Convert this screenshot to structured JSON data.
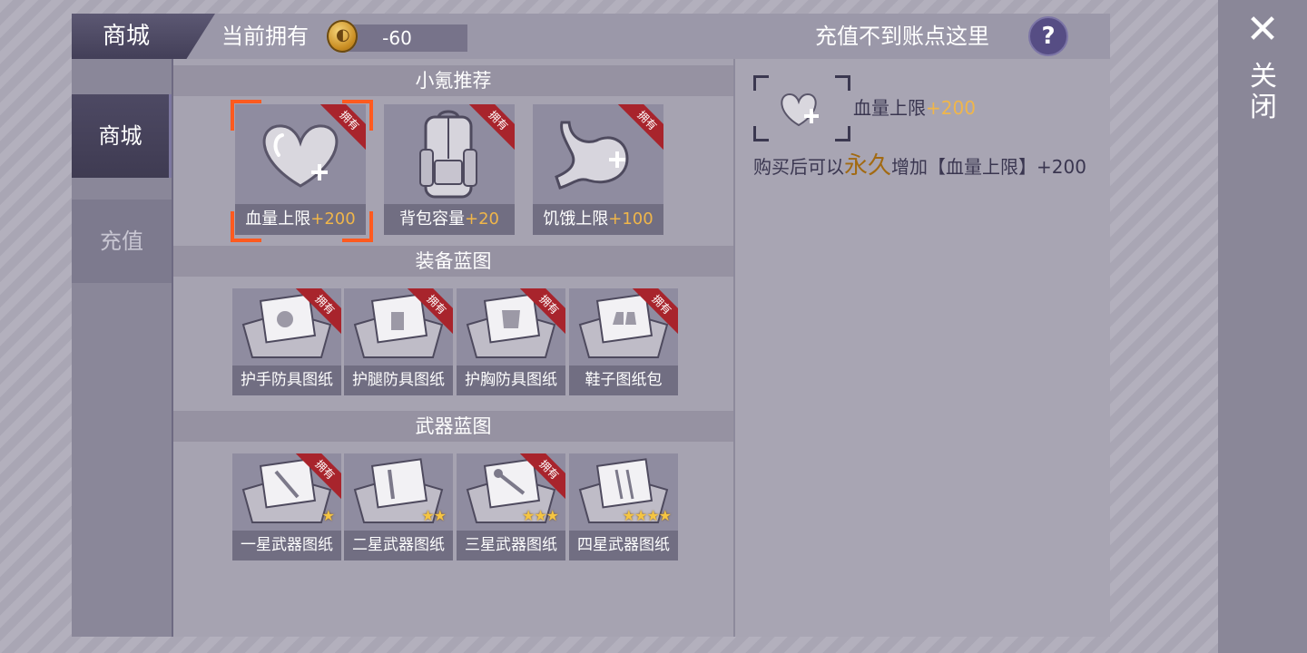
{
  "header": {
    "tab_label": "商城",
    "owned_label": "当前拥有",
    "coin_value": "-60",
    "recharge_help": "充值不到账点这里",
    "help_symbol": "?"
  },
  "nav": {
    "items": [
      {
        "label": "商城"
      },
      {
        "label": "充值"
      }
    ]
  },
  "close": {
    "symbol": "✕",
    "label": "关闭"
  },
  "sections": [
    {
      "title": "小氪推荐",
      "items": [
        {
          "name": "血量上限",
          "bonus": "+200",
          "owned": "拥有",
          "icon": "heart-plus-icon"
        },
        {
          "name": "背包容量",
          "bonus": "+20",
          "owned": "拥有",
          "icon": "backpack-icon"
        },
        {
          "name": "饥饿上限",
          "bonus": "+100",
          "owned": "拥有",
          "icon": "stomach-plus-icon"
        }
      ]
    },
    {
      "title": "装备蓝图",
      "items": [
        {
          "name": "护手防具图纸",
          "owned": "拥有",
          "icon": "blueprint-toolbox-icon"
        },
        {
          "name": "护腿防具图纸",
          "owned": "拥有",
          "icon": "blueprint-toolbox-icon"
        },
        {
          "name": "护胸防具图纸",
          "owned": "拥有",
          "icon": "blueprint-toolbox-icon"
        },
        {
          "name": "鞋子图纸包",
          "owned": "拥有",
          "icon": "blueprint-toolbox-icon"
        }
      ]
    },
    {
      "title": "武器蓝图",
      "items": [
        {
          "name": "一星武器图纸",
          "owned": "拥有",
          "stars": "★",
          "icon": "blueprint-toolbox-icon"
        },
        {
          "name": "二星武器图纸",
          "owned": "",
          "stars": "★★",
          "icon": "blueprint-toolbox-icon"
        },
        {
          "name": "三星武器图纸",
          "owned": "拥有",
          "stars": "★★★",
          "icon": "blueprint-toolbox-icon"
        },
        {
          "name": "四星武器图纸",
          "owned": "",
          "stars": "★★★★",
          "icon": "blueprint-toolbox-icon"
        }
      ]
    }
  ],
  "detail": {
    "name": "血量上限",
    "bonus": "+200",
    "desc_prefix": "购买后可以",
    "desc_emph": "永久",
    "desc_suffix": "增加【血量上限】+200"
  },
  "colors": {
    "accent_gold": "#f0b64a",
    "selection": "#ff5a1f",
    "ribbon": "#a8242c",
    "perm_text": "#a26a12"
  }
}
